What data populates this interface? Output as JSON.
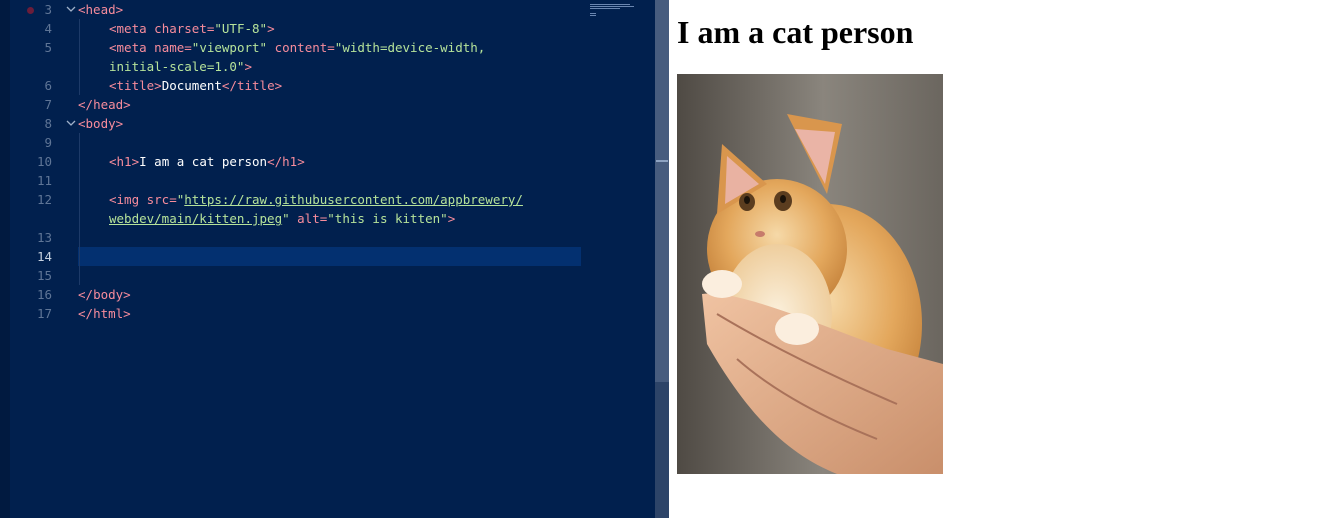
{
  "editor": {
    "line_numbers": [
      "3",
      "4",
      "5",
      "",
      "6",
      "7",
      "8",
      "9",
      "10",
      "11",
      "12",
      "",
      "13",
      "14",
      "15",
      "16",
      "17"
    ],
    "active_line": "14",
    "lines": {
      "l3_open": "<",
      "l3_tag": "head",
      "l3_close": ">",
      "l4_open": "<",
      "l4_tag": "meta",
      "l4_attr": " charset=",
      "l4_val": "\"UTF-8\"",
      "l4_close": ">",
      "l5_open": "<",
      "l5_tag": "meta",
      "l5_attr1": " name=",
      "l5_val1": "\"viewport\"",
      "l5_attr2": " content=",
      "l5_val2a": "\"width=device-width,",
      "l5b_val2b": "initial-scale=1.0\"",
      "l5b_close": ">",
      "l6_open": "<",
      "l6_tag": "title",
      "l6_gt": ">",
      "l6_text": "Document",
      "l6_end": "</",
      "l6_etag": "title",
      "l6_close": ">",
      "l7_end": "</",
      "l7_tag": "head",
      "l7_close": ">",
      "l8_open": "<",
      "l8_tag": "body",
      "l8_close": ">",
      "l10_open": "<",
      "l10_tag": "h1",
      "l10_gt": ">",
      "l10_text": "I am a cat person",
      "l10_end": "</",
      "l10_etag": "h1",
      "l10_close": ">",
      "l12_open": "<",
      "l12_tag": "img",
      "l12_attr": " src=",
      "l12_q": "\"",
      "l12_url1": "https://raw.githubusercontent.com/appbrewery/",
      "l12b_url2": "webdev/main/kitten.jpeg",
      "l12b_q": "\"",
      "l12b_attr": " alt=",
      "l12b_val": "\"this is kitten\"",
      "l12b_close": ">",
      "l16_end": "</",
      "l16_tag": "body",
      "l16_close": ">",
      "l17_end": "</",
      "l17_tag": "html",
      "l17_close": ">"
    }
  },
  "preview": {
    "heading": "I am a cat person",
    "image_alt": "this is kitten"
  },
  "colors": {
    "editor_bg": "#01204e",
    "tag": "#f78c9c",
    "string": "#b6e39a",
    "line_highlight": "#033070"
  },
  "icons": {
    "fold": "chevron-down-icon",
    "breakpoint": "breakpoint-dot-icon"
  }
}
